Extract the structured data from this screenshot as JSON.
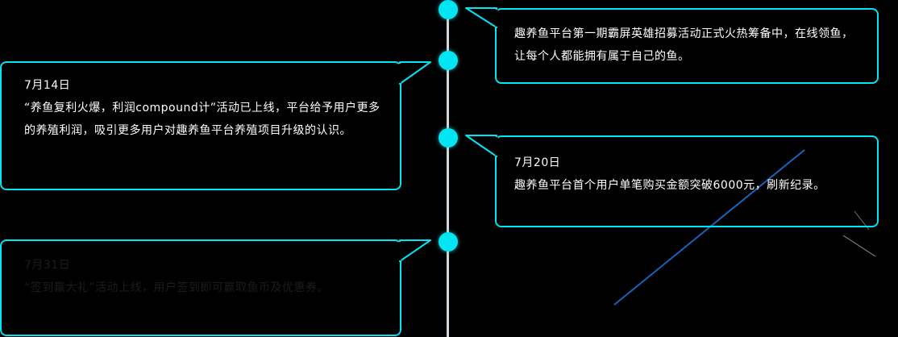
{
  "timeline": {
    "events": [
      {
        "id": "event-1",
        "date": "",
        "text": "趣养鱼平台第一期霸屏英雄招募活动正式火热筹备中，在线领鱼，让每个人都能拥有属于自己的鱼。"
      },
      {
        "id": "event-2",
        "date": "7月14日",
        "text": "“养鱼复利火爆，利润compound计”活动已上线，平台给予用户更多的养殖利润，吸引更多用户对趣养鱼平台养殖项目升级的认识。"
      },
      {
        "id": "event-3",
        "date": "7月20日",
        "text": "趣养鱼平台首个用户单笔购买金额突破6000元，刷新纪录。"
      },
      {
        "id": "event-4",
        "date": "7月31日",
        "text": "“签到赢大礼”活动上线，用户签到即可赢取鱼币及优惠券。"
      }
    ]
  },
  "colors": {
    "accent": "#00e5f2",
    "spine": "#cfd6dc",
    "background": "#000000",
    "text": "#ffffff"
  }
}
